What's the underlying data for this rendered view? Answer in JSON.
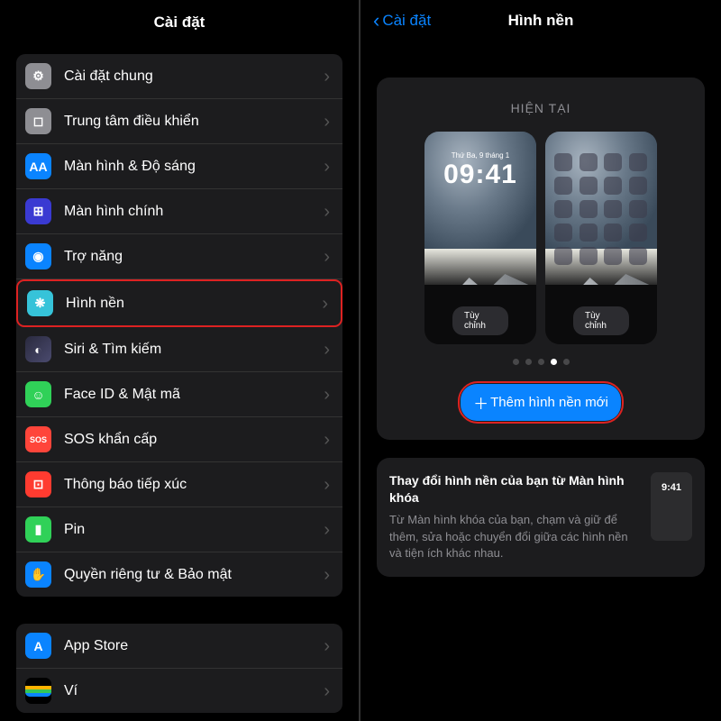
{
  "left": {
    "title": "Cài đặt",
    "groups": [
      [
        {
          "icon": "gear",
          "label": "Cài đặt chung"
        },
        {
          "icon": "cc",
          "label": "Trung tâm điều khiển"
        },
        {
          "icon": "disp",
          "label": "Màn hình & Độ sáng",
          "glyph": "AA"
        },
        {
          "icon": "home",
          "label": "Màn hình chính"
        },
        {
          "icon": "acc",
          "label": "Trợ năng"
        },
        {
          "icon": "wall",
          "label": "Hình nền",
          "highlight": true
        },
        {
          "icon": "siri",
          "label": "Siri & Tìm kiếm"
        },
        {
          "icon": "face",
          "label": "Face ID & Mật mã"
        },
        {
          "icon": "sos",
          "label": "SOS khẩn cấp",
          "glyph": "SOS"
        },
        {
          "icon": "expose",
          "label": "Thông báo tiếp xúc"
        },
        {
          "icon": "batt",
          "label": "Pin"
        },
        {
          "icon": "priv",
          "label": "Quyền riêng tư & Bảo mật"
        }
      ],
      [
        {
          "icon": "app",
          "label": "App Store",
          "glyph": "A"
        },
        {
          "icon": "wal",
          "label": "Ví"
        }
      ]
    ]
  },
  "right": {
    "back": "Cài đặt",
    "title": "Hình nền",
    "current": "HIỆN TẠI",
    "lock_date": "Thứ Ba, 9 tháng 1",
    "lock_time": "09:41",
    "customize": "Tùy chỉnh",
    "customize2": "Tùy chỉnh",
    "add": "Thêm hình nền mới",
    "plus": "＋",
    "hint_title": "Thay đổi hình nền của bạn từ Màn hình khóa",
    "hint_body": "Từ Màn hình khóa của bạn, chạm và giữ để thêm, sửa hoặc chuyển đổi giữa các hình nền và tiện ích khác nhau.",
    "mini_time": "9:41",
    "page_index": 3,
    "page_count": 5
  }
}
